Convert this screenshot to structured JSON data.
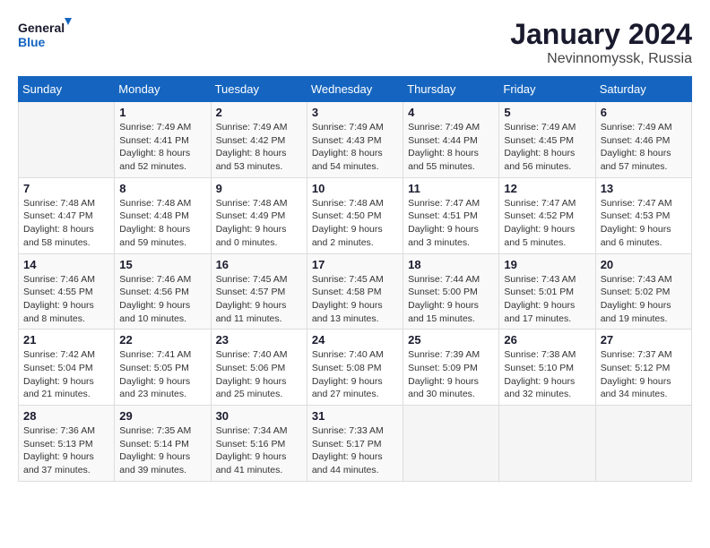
{
  "header": {
    "logo_line1": "General",
    "logo_line2": "Blue",
    "month": "January 2024",
    "location": "Nevinnomyssk, Russia"
  },
  "weekdays": [
    "Sunday",
    "Monday",
    "Tuesday",
    "Wednesday",
    "Thursday",
    "Friday",
    "Saturday"
  ],
  "weeks": [
    [
      {
        "day": "",
        "sunrise": "",
        "sunset": "",
        "daylight": ""
      },
      {
        "day": "1",
        "sunrise": "Sunrise: 7:49 AM",
        "sunset": "Sunset: 4:41 PM",
        "daylight": "Daylight: 8 hours and 52 minutes."
      },
      {
        "day": "2",
        "sunrise": "Sunrise: 7:49 AM",
        "sunset": "Sunset: 4:42 PM",
        "daylight": "Daylight: 8 hours and 53 minutes."
      },
      {
        "day": "3",
        "sunrise": "Sunrise: 7:49 AM",
        "sunset": "Sunset: 4:43 PM",
        "daylight": "Daylight: 8 hours and 54 minutes."
      },
      {
        "day": "4",
        "sunrise": "Sunrise: 7:49 AM",
        "sunset": "Sunset: 4:44 PM",
        "daylight": "Daylight: 8 hours and 55 minutes."
      },
      {
        "day": "5",
        "sunrise": "Sunrise: 7:49 AM",
        "sunset": "Sunset: 4:45 PM",
        "daylight": "Daylight: 8 hours and 56 minutes."
      },
      {
        "day": "6",
        "sunrise": "Sunrise: 7:49 AM",
        "sunset": "Sunset: 4:46 PM",
        "daylight": "Daylight: 8 hours and 57 minutes."
      }
    ],
    [
      {
        "day": "7",
        "sunrise": "Sunrise: 7:48 AM",
        "sunset": "Sunset: 4:47 PM",
        "daylight": "Daylight: 8 hours and 58 minutes."
      },
      {
        "day": "8",
        "sunrise": "Sunrise: 7:48 AM",
        "sunset": "Sunset: 4:48 PM",
        "daylight": "Daylight: 8 hours and 59 minutes."
      },
      {
        "day": "9",
        "sunrise": "Sunrise: 7:48 AM",
        "sunset": "Sunset: 4:49 PM",
        "daylight": "Daylight: 9 hours and 0 minutes."
      },
      {
        "day": "10",
        "sunrise": "Sunrise: 7:48 AM",
        "sunset": "Sunset: 4:50 PM",
        "daylight": "Daylight: 9 hours and 2 minutes."
      },
      {
        "day": "11",
        "sunrise": "Sunrise: 7:47 AM",
        "sunset": "Sunset: 4:51 PM",
        "daylight": "Daylight: 9 hours and 3 minutes."
      },
      {
        "day": "12",
        "sunrise": "Sunrise: 7:47 AM",
        "sunset": "Sunset: 4:52 PM",
        "daylight": "Daylight: 9 hours and 5 minutes."
      },
      {
        "day": "13",
        "sunrise": "Sunrise: 7:47 AM",
        "sunset": "Sunset: 4:53 PM",
        "daylight": "Daylight: 9 hours and 6 minutes."
      }
    ],
    [
      {
        "day": "14",
        "sunrise": "Sunrise: 7:46 AM",
        "sunset": "Sunset: 4:55 PM",
        "daylight": "Daylight: 9 hours and 8 minutes."
      },
      {
        "day": "15",
        "sunrise": "Sunrise: 7:46 AM",
        "sunset": "Sunset: 4:56 PM",
        "daylight": "Daylight: 9 hours and 10 minutes."
      },
      {
        "day": "16",
        "sunrise": "Sunrise: 7:45 AM",
        "sunset": "Sunset: 4:57 PM",
        "daylight": "Daylight: 9 hours and 11 minutes."
      },
      {
        "day": "17",
        "sunrise": "Sunrise: 7:45 AM",
        "sunset": "Sunset: 4:58 PM",
        "daylight": "Daylight: 9 hours and 13 minutes."
      },
      {
        "day": "18",
        "sunrise": "Sunrise: 7:44 AM",
        "sunset": "Sunset: 5:00 PM",
        "daylight": "Daylight: 9 hours and 15 minutes."
      },
      {
        "day": "19",
        "sunrise": "Sunrise: 7:43 AM",
        "sunset": "Sunset: 5:01 PM",
        "daylight": "Daylight: 9 hours and 17 minutes."
      },
      {
        "day": "20",
        "sunrise": "Sunrise: 7:43 AM",
        "sunset": "Sunset: 5:02 PM",
        "daylight": "Daylight: 9 hours and 19 minutes."
      }
    ],
    [
      {
        "day": "21",
        "sunrise": "Sunrise: 7:42 AM",
        "sunset": "Sunset: 5:04 PM",
        "daylight": "Daylight: 9 hours and 21 minutes."
      },
      {
        "day": "22",
        "sunrise": "Sunrise: 7:41 AM",
        "sunset": "Sunset: 5:05 PM",
        "daylight": "Daylight: 9 hours and 23 minutes."
      },
      {
        "day": "23",
        "sunrise": "Sunrise: 7:40 AM",
        "sunset": "Sunset: 5:06 PM",
        "daylight": "Daylight: 9 hours and 25 minutes."
      },
      {
        "day": "24",
        "sunrise": "Sunrise: 7:40 AM",
        "sunset": "Sunset: 5:08 PM",
        "daylight": "Daylight: 9 hours and 27 minutes."
      },
      {
        "day": "25",
        "sunrise": "Sunrise: 7:39 AM",
        "sunset": "Sunset: 5:09 PM",
        "daylight": "Daylight: 9 hours and 30 minutes."
      },
      {
        "day": "26",
        "sunrise": "Sunrise: 7:38 AM",
        "sunset": "Sunset: 5:10 PM",
        "daylight": "Daylight: 9 hours and 32 minutes."
      },
      {
        "day": "27",
        "sunrise": "Sunrise: 7:37 AM",
        "sunset": "Sunset: 5:12 PM",
        "daylight": "Daylight: 9 hours and 34 minutes."
      }
    ],
    [
      {
        "day": "28",
        "sunrise": "Sunrise: 7:36 AM",
        "sunset": "Sunset: 5:13 PM",
        "daylight": "Daylight: 9 hours and 37 minutes."
      },
      {
        "day": "29",
        "sunrise": "Sunrise: 7:35 AM",
        "sunset": "Sunset: 5:14 PM",
        "daylight": "Daylight: 9 hours and 39 minutes."
      },
      {
        "day": "30",
        "sunrise": "Sunrise: 7:34 AM",
        "sunset": "Sunset: 5:16 PM",
        "daylight": "Daylight: 9 hours and 41 minutes."
      },
      {
        "day": "31",
        "sunrise": "Sunrise: 7:33 AM",
        "sunset": "Sunset: 5:17 PM",
        "daylight": "Daylight: 9 hours and 44 minutes."
      },
      {
        "day": "",
        "sunrise": "",
        "sunset": "",
        "daylight": ""
      },
      {
        "day": "",
        "sunrise": "",
        "sunset": "",
        "daylight": ""
      },
      {
        "day": "",
        "sunrise": "",
        "sunset": "",
        "daylight": ""
      }
    ]
  ]
}
